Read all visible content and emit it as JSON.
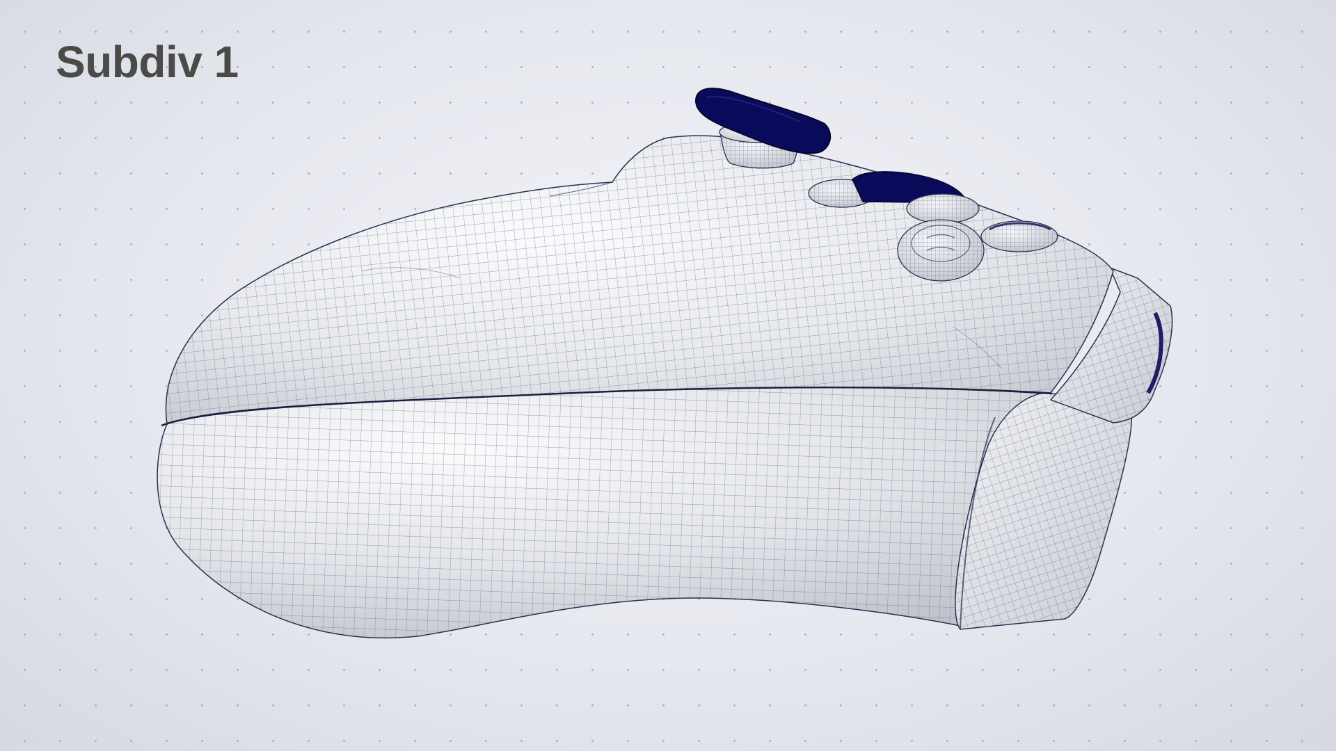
{
  "viewport": {
    "subdivision_label": "Subdiv 1",
    "accent_color": "#0a0a5a",
    "surface_color": "#eef0f3",
    "background_color": "#e6e8ef"
  },
  "model": {
    "object": "gamepad-controller",
    "display_mode": "wireframe-on-shaded"
  }
}
